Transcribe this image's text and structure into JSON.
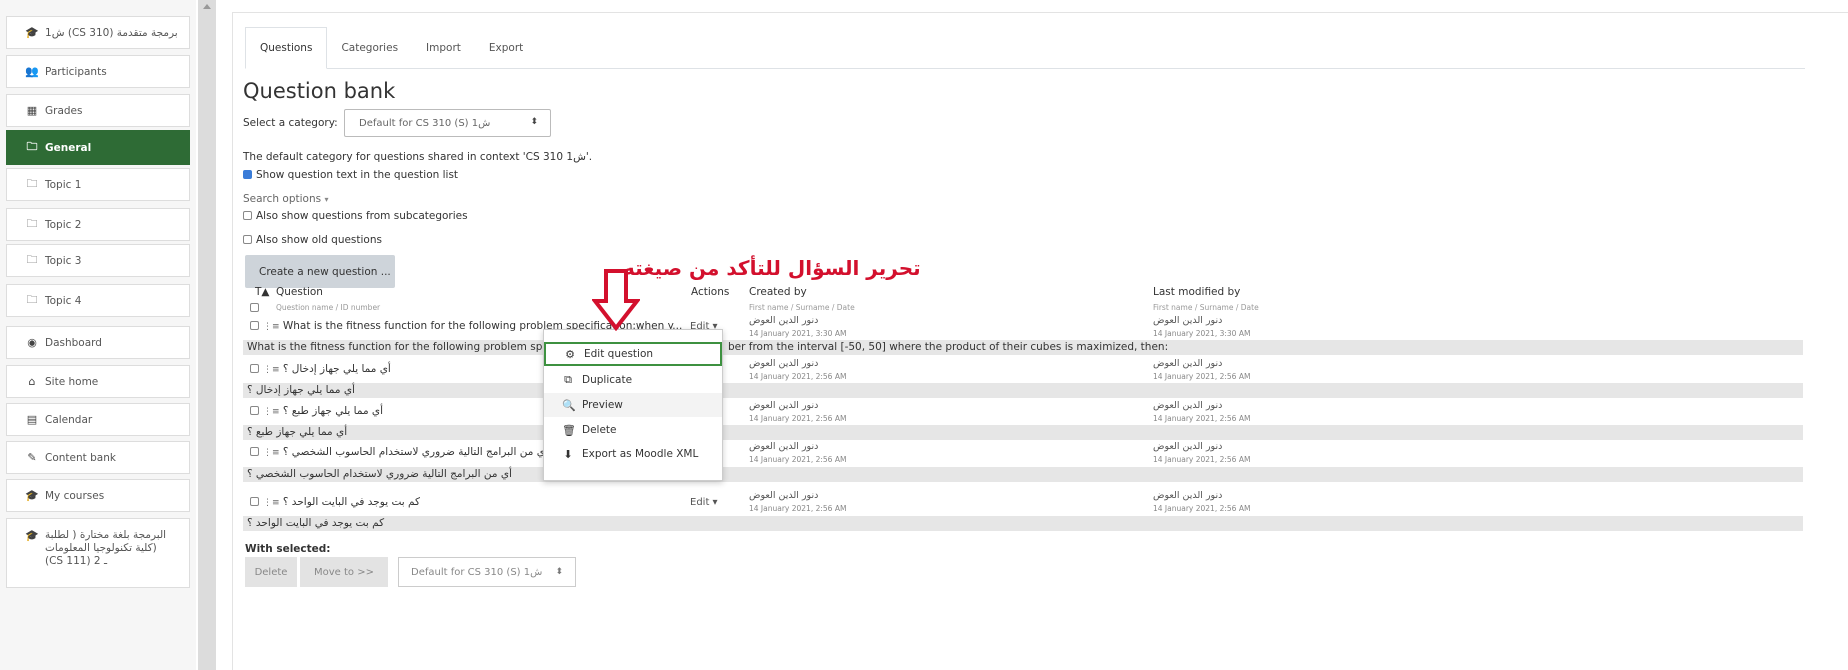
{
  "sidebar": {
    "items": [
      {
        "icon": "graduation-cap-icon",
        "glyph": "🎓",
        "label": "ش1 (CS 310) برمجة متقدمة"
      },
      {
        "icon": "users-icon",
        "glyph": "👥",
        "label": "Participants"
      },
      {
        "icon": "table-icon",
        "glyph": "▦",
        "label": "Grades"
      },
      {
        "icon": "folder-icon",
        "glyph": "🗀",
        "label": "General"
      },
      {
        "icon": "folder-icon",
        "glyph": "🗀",
        "label": "Topic 1"
      },
      {
        "icon": "folder-icon",
        "glyph": "🗀",
        "label": "Topic 2"
      },
      {
        "icon": "folder-icon",
        "glyph": "🗀",
        "label": "Topic 3"
      },
      {
        "icon": "folder-icon",
        "glyph": "🗀",
        "label": "Topic 4"
      },
      {
        "icon": "dashboard-icon",
        "glyph": "◉",
        "label": "Dashboard"
      },
      {
        "icon": "home-icon",
        "glyph": "⌂",
        "label": "Site home"
      },
      {
        "icon": "calendar-icon",
        "glyph": "▤",
        "label": "Calendar"
      },
      {
        "icon": "pencil-icon",
        "glyph": "✎",
        "label": "Content bank"
      },
      {
        "icon": "graduation-cap-icon",
        "glyph": "🎓",
        "label": "My courses"
      },
      {
        "icon": "graduation-cap-icon",
        "glyph": "🎓",
        "label_lines": [
          "البرمجة بلغة مختارة ( لطلبة",
          "كلية تكنولوجيا المعلومات)",
          "(CS 111) 2 ـ"
        ]
      }
    ],
    "active_index": 3
  },
  "tabs": [
    "Questions",
    "Categories",
    "Import",
    "Export"
  ],
  "title": "Question bank",
  "category": {
    "label": "Select a category:",
    "selected": "Default for CS 310 (S) ش1"
  },
  "info_text": "The default category for questions shared in context 'CS 310 ش1'.",
  "show_question_text": "Show question text in the question list",
  "search_options": "Search options",
  "also_subcategories": "Also show questions from subcategories",
  "also_old": "Also show old questions",
  "create_button": "Create a new question ...",
  "table": {
    "sort_icon": "T▲",
    "col_question": "Question",
    "col_question_sub": "Question name / ID number",
    "col_actions": "Actions",
    "col_created": "Created by",
    "col_created_sub": "First name / Surname / Date",
    "col_modified": "Last modified by",
    "col_modified_sub": "First name / Surname / Date"
  },
  "rows": [
    {
      "name": "What is the fitness function for the following problem specification:when y...",
      "edit": "Edit",
      "created_name": "دنور الدين العوض",
      "created_date": "14 January 2021, 3:30 AM",
      "modified_name": "دنور الدين العوض",
      "modified_date": "14 January 2021, 3:30 AM",
      "text": "What is the fitness function for the following problem sp",
      "text_tail": "ber from the interval [-50, 50] where the product of their cubes is maximized, then:"
    },
    {
      "name": "أي مما يلي جهاز إدخال ؟",
      "created_name": "دنور الدين العوض",
      "created_date": "14 January 2021, 2:56 AM",
      "modified_name": "دنور الدين العوض",
      "modified_date": "14 January 2021, 2:56 AM",
      "text": "أي مما يلي جهاز إدخال ؟"
    },
    {
      "name": "أي مما يلي جهاز طبع ؟",
      "created_name": "دنور الدين العوض",
      "created_date": "14 January 2021, 2:56 AM",
      "modified_name": "دنور الدين العوض",
      "modified_date": "14 January 2021, 2:56 AM",
      "text": "أي مما يلي جهاز طبع ؟"
    },
    {
      "name": "أي من البرامج التالية ضروري لاستخدام الحاسوب الشخصي ؟",
      "created_name": "دنور الدين العوض",
      "created_date": "14 January 2021, 2:56 AM",
      "modified_name": "دنور الدين العوض",
      "modified_date": "14 January 2021, 2:56 AM",
      "text": "أي من البرامج التالية ضروري لاستخدام الحاسوب الشخصي ؟"
    },
    {
      "name": "كم بت يوجد في البايت الواحد ؟",
      "edit": "Edit",
      "created_name": "دنور الدين العوض",
      "created_date": "14 January 2021, 2:56 AM",
      "modified_name": "دنور الدين العوض",
      "modified_date": "14 January 2021, 2:56 AM",
      "text": "كم بت يوجد في البايت الواحد ؟"
    }
  ],
  "menu": [
    {
      "icon": "gear-icon",
      "glyph": "⚙",
      "label": "Edit question"
    },
    {
      "icon": "copy-icon",
      "glyph": "⧉",
      "label": "Duplicate"
    },
    {
      "icon": "magnifier-icon",
      "glyph": "🔍",
      "label": "Preview"
    },
    {
      "icon": "trash-icon",
      "glyph": "🗑",
      "label": "Delete"
    },
    {
      "icon": "download-icon",
      "glyph": "⬇",
      "label": "Export as Moodle XML"
    }
  ],
  "annotation": "تحرير السؤال للتأكد من صيغته",
  "with_selected": {
    "label": "With selected:",
    "delete": "Delete",
    "move_to": "Move to >>",
    "category": "Default for CS 310 (S) ش1"
  },
  "colors": {
    "active_nav": "#2e6b35",
    "annotation": "#d3102d",
    "highlight_border": "#3d9140"
  }
}
